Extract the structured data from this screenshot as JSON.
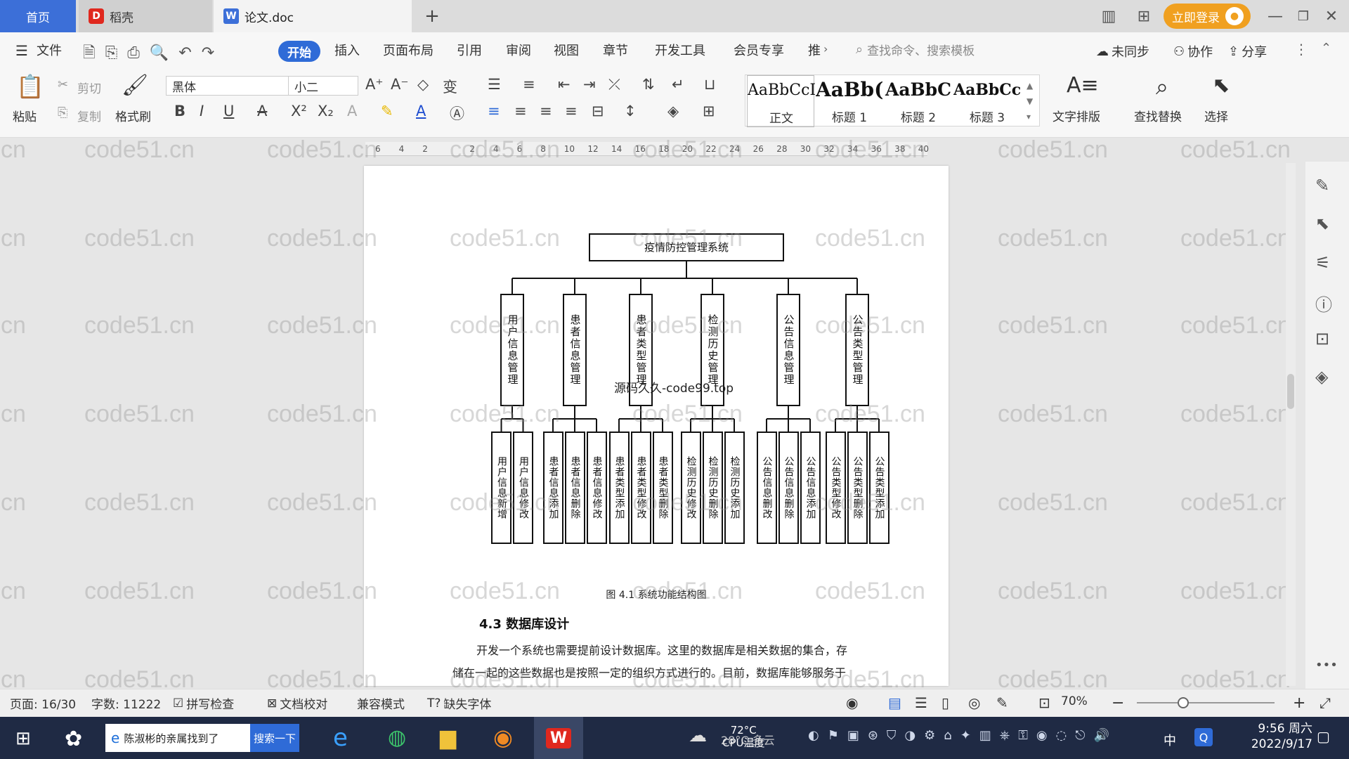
{
  "colors": {
    "accent": "#2f6bd7",
    "login": "#f0a020",
    "taskbar": "#1f2a44"
  },
  "tabs": {
    "home": "首页",
    "daoke": "稻壳",
    "doc": "论文.doc",
    "new": "+",
    "login": "立即登录"
  },
  "menu": {
    "file": "文件",
    "start": "开始",
    "insert": "插入",
    "layout": "页面布局",
    "ref": "引用",
    "review": "审阅",
    "view": "视图",
    "chapter": "章节",
    "dev": "开发工具",
    "vip": "会员专享",
    "more": "推",
    "search": "查找命令、搜索模板",
    "sync": "未同步",
    "collab": "协作",
    "share": "分享"
  },
  "ribbon": {
    "paste": "粘贴",
    "cut": "剪切",
    "copy": "复制",
    "format_painter": "格式刷",
    "font": "黑体",
    "size": "小二",
    "styles": [
      {
        "sample": "AaBbCcI",
        "name": "正文"
      },
      {
        "sample": "AaBb(",
        "name": "标题 1"
      },
      {
        "sample": "AaBbC",
        "name": "标题 2"
      },
      {
        "sample": "AaBbCcl",
        "name": "标题 3"
      }
    ],
    "text_layout": "文字排版",
    "find_replace": "查找替换",
    "select": "选择"
  },
  "ruler": [
    "6",
    "4",
    "2",
    "",
    "2",
    "4",
    "6",
    "8",
    "10",
    "12",
    "14",
    "16",
    "18",
    "20",
    "22",
    "24",
    "26",
    "28",
    "30",
    "32",
    "34",
    "36",
    "38",
    "40"
  ],
  "document": {
    "root": "疫情防控管理系统",
    "modules": [
      {
        "name": "用户信息管理",
        "children": [
          "用户信息新增",
          "用户信息修改"
        ]
      },
      {
        "name": "患者信息管理",
        "children": [
          "患者信息添加",
          "患者信息删除",
          "患者信息修改"
        ]
      },
      {
        "name": "患者类型管理",
        "children": [
          "患者类型添加",
          "患者类型修改",
          "患者类型删除"
        ]
      },
      {
        "name": "检测历史管理",
        "children": [
          "检测历史修改",
          "检测历史删除",
          "检测历史添加"
        ]
      },
      {
        "name": "公告信息管理",
        "children": [
          "公告信息删改",
          "公告信息删除",
          "公告信息添加"
        ]
      },
      {
        "name": "公告类型管理",
        "children": [
          "公告类型修改",
          "公告类型删除",
          "公告类型添加"
        ]
      }
    ],
    "overlay": "源码久久-code99.top",
    "caption": "图 4.1  系统功能结构图",
    "heading": "4.3  数据库设计",
    "para1": "开发一个系统也需要提前设计数据库。这里的数据库是相关数据的集合，存",
    "para2": "储在一起的这些数据也是按照一定的组织方式进行的。目前，数据库能够服务于",
    "watermark": "code51.cn"
  },
  "status": {
    "page": "页面: 16/30",
    "words": "字数: 11222",
    "spell": "拼写检查",
    "proof": "文档校对",
    "compat": "兼容模式",
    "missing_font": "缺失字体",
    "zoom": "70%"
  },
  "taskbar": {
    "news": "陈淑彬的亲属找到了",
    "search_btn": "搜索一下",
    "weather_temp": "28°C 多云",
    "cpu_temp": "72°C",
    "cpu_label": "CPU温度",
    "ime": "中",
    "time": "9:56 周六",
    "date": "2022/9/17"
  }
}
